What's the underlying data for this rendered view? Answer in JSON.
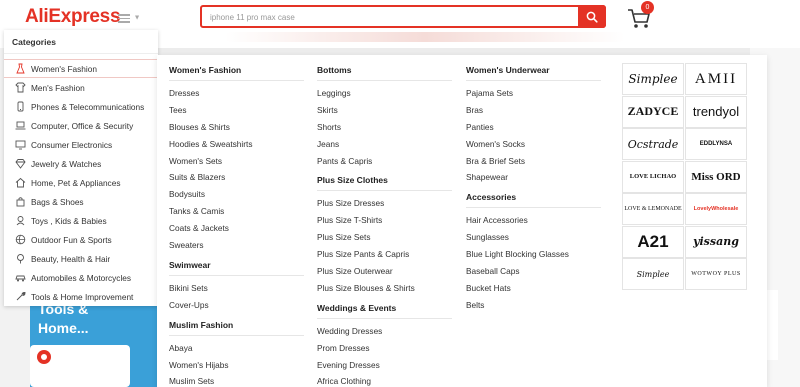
{
  "header": {
    "logo": "AliExpress",
    "search_value": "iphone 11 pro max case",
    "cart_count": "0"
  },
  "background": {
    "more_text": "ore",
    "promo_text": "Tools & Home..."
  },
  "categories": {
    "title": "Categories",
    "items": [
      {
        "label": "Women's Fashion",
        "icon": "dress-icon"
      },
      {
        "label": "Men's Fashion",
        "icon": "shirt-icon"
      },
      {
        "label": "Phones & Telecommunications",
        "icon": "phone-icon"
      },
      {
        "label": "Computer, Office & Security",
        "icon": "laptop-icon"
      },
      {
        "label": "Consumer Electronics",
        "icon": "tv-icon"
      },
      {
        "label": "Jewelry & Watches",
        "icon": "diamond-icon"
      },
      {
        "label": "Home, Pet & Appliances",
        "icon": "home-icon"
      },
      {
        "label": "Bags & Shoes",
        "icon": "bag-icon"
      },
      {
        "label": "Toys , Kids & Babies",
        "icon": "toy-icon"
      },
      {
        "label": "Outdoor Fun & Sports",
        "icon": "ball-icon"
      },
      {
        "label": "Beauty, Health & Hair",
        "icon": "beauty-icon"
      },
      {
        "label": "Automobiles & Motorcycles",
        "icon": "car-icon"
      },
      {
        "label": "Tools & Home Improvement",
        "icon": "tools-icon"
      }
    ]
  },
  "mega": {
    "col1": [
      {
        "title": "Women's Fashion",
        "items": [
          "Dresses",
          "Tees",
          "Blouses & Shirts",
          "Hoodies & Sweatshirts",
          "Women's Sets",
          "Suits & Blazers",
          "Bodysuits",
          "Tanks & Camis",
          "Coats & Jackets",
          "Sweaters"
        ]
      },
      {
        "title": "Swimwear",
        "items": [
          "Bikini Sets",
          "Cover-Ups"
        ]
      },
      {
        "title": "Muslim Fashion",
        "items": [
          "Abaya",
          "Women's Hijabs",
          "Muslim Sets"
        ]
      }
    ],
    "col2": [
      {
        "title": "Bottoms",
        "items": [
          "Leggings",
          "Skirts",
          "Shorts",
          "Jeans",
          "Pants & Capris"
        ]
      },
      {
        "title": "Plus Size Clothes",
        "items": [
          "Plus Size Dresses",
          "Plus Size T-Shirts",
          "Plus Size Sets",
          "Plus Size Pants & Capris",
          "Plus Size Outerwear",
          "Plus Size Blouses & Shirts"
        ]
      },
      {
        "title": "Weddings & Events",
        "items": [
          "Wedding Dresses",
          "Prom Dresses",
          "Evening Dresses",
          "Africa Clothing"
        ]
      }
    ],
    "col3": [
      {
        "title": "Women's Underwear",
        "items": [
          "Pajama Sets",
          "Bras",
          "Panties",
          "Women's Socks",
          "Bra & Brief Sets",
          "Shapewear"
        ]
      },
      {
        "title": "Accessories",
        "items": [
          "Hair Accessories",
          "Sunglasses",
          "Blue Light Blocking Glasses",
          "Baseball Caps",
          "Bucket Hats",
          "Belts"
        ]
      }
    ],
    "brands": [
      "Simplee",
      "AMII",
      "ZADYCE",
      "trendyol",
      "Ocstrade",
      "EDDLYNSA",
      "LOVE LICHAO",
      "Miss ORD",
      "LOVE & LEMONADE",
      "LovelyWholesale",
      "A21",
      "yissang",
      "Simplee",
      "WOTWOY PLUS"
    ]
  },
  "colors": {
    "brand_red": "#e43225",
    "promo_blue": "#3aa0d8"
  }
}
